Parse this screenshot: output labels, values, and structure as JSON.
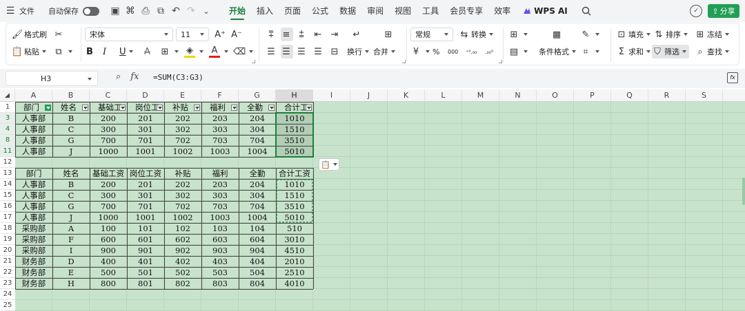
{
  "menubar": {
    "file_label": "文件",
    "autosave_label": "自动保存",
    "tabs": [
      "开始",
      "插入",
      "页面",
      "公式",
      "数据",
      "审阅",
      "视图",
      "工具",
      "会员专享",
      "效率"
    ],
    "wps_ai_label": "WPS AI",
    "share_label": "分享",
    "accent": "#17803b"
  },
  "ribbon": {
    "format_painter": "格式刷",
    "paste": "粘贴",
    "font_name": "宋体",
    "font_size": "11",
    "bold": "B",
    "italic": "I",
    "underline": "U",
    "strike": "A",
    "wrap": "换行",
    "merge": "合并",
    "number_format": "常规",
    "convert": "转换",
    "percent": "%",
    "thousands": "000",
    "conditional": "条件格式",
    "fill": "填充",
    "sort": "排序",
    "freeze": "冻结",
    "sum": "求和",
    "filter": "筛选",
    "find": "查找"
  },
  "formula_bar": {
    "name_box": "H3",
    "fx": "fx",
    "formula": "=SUM(C3:G3)"
  },
  "columns": [
    "A",
    "B",
    "C",
    "D",
    "E",
    "F",
    "G",
    "H",
    "I",
    "J",
    "K",
    "L",
    "M",
    "N",
    "O",
    "P",
    "Q",
    "R",
    "S"
  ],
  "rows": [
    "1",
    "3",
    "4",
    "8",
    "11",
    "12",
    "13",
    "14",
    "15",
    "16",
    "17",
    "18",
    "19",
    "20",
    "21",
    "22",
    "23",
    "24",
    "25"
  ],
  "table1": {
    "headers": [
      "部门",
      "姓名",
      "基础工",
      "岗位工",
      "补贴",
      "福利",
      "全勤",
      "合计工"
    ],
    "rows": [
      [
        "人事部",
        "B",
        "200",
        "201",
        "202",
        "203",
        "204",
        "1010"
      ],
      [
        "人事部",
        "C",
        "300",
        "301",
        "302",
        "303",
        "304",
        "1510"
      ],
      [
        "人事部",
        "G",
        "700",
        "701",
        "702",
        "703",
        "704",
        "3510"
      ],
      [
        "人事部",
        "J",
        "1000",
        "1001",
        "1002",
        "1003",
        "1004",
        "5010"
      ]
    ]
  },
  "table2": {
    "headers": [
      "部门",
      "姓名",
      "基础工资",
      "岗位工资",
      "补贴",
      "福利",
      "全勤",
      "合计工资"
    ],
    "rows": [
      [
        "人事部",
        "B",
        "200",
        "201",
        "202",
        "203",
        "204",
        "1010"
      ],
      [
        "人事部",
        "C",
        "300",
        "301",
        "302",
        "303",
        "304",
        "1510"
      ],
      [
        "人事部",
        "G",
        "700",
        "701",
        "702",
        "703",
        "704",
        "3510"
      ],
      [
        "人事部",
        "J",
        "1000",
        "1001",
        "1002",
        "1003",
        "1004",
        "5010"
      ],
      [
        "采购部",
        "A",
        "100",
        "101",
        "102",
        "103",
        "104",
        "510"
      ],
      [
        "采购部",
        "F",
        "600",
        "601",
        "602",
        "603",
        "604",
        "3010"
      ],
      [
        "采购部",
        "I",
        "900",
        "901",
        "902",
        "903",
        "904",
        "4510"
      ],
      [
        "财务部",
        "D",
        "400",
        "401",
        "402",
        "403",
        "404",
        "2010"
      ],
      [
        "财务部",
        "E",
        "500",
        "501",
        "502",
        "503",
        "504",
        "2510"
      ],
      [
        "财务部",
        "H",
        "800",
        "801",
        "802",
        "803",
        "804",
        "4010"
      ]
    ]
  }
}
